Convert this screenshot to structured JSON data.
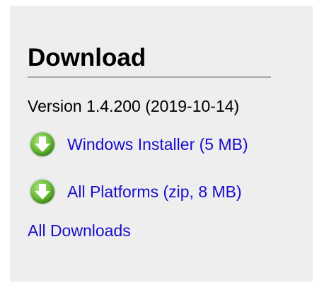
{
  "download": {
    "title": "Download",
    "version_text": "Version 1.4.200 (2019-10-14)",
    "links": [
      {
        "label": "Windows Installer (5 MB)",
        "icon": "download-arrow-icon"
      },
      {
        "label": "All Platforms (zip, 8 MB)",
        "icon": "download-arrow-icon"
      }
    ],
    "all_downloads_label": "All Downloads"
  },
  "colors": {
    "panel_background": "#eeeeee",
    "link": "#1a0dcc",
    "icon_green": "#6fbf3a",
    "divider": "#aaaaaa"
  }
}
